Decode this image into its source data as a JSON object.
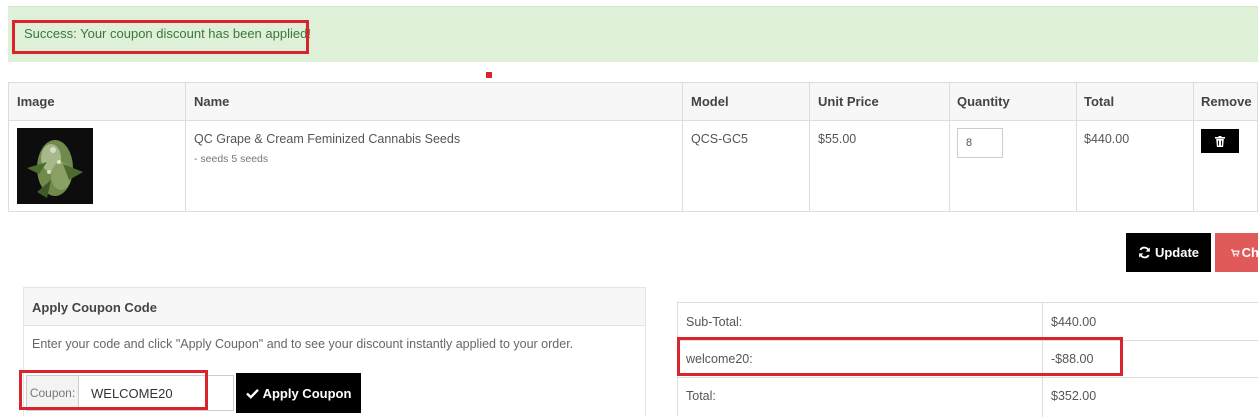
{
  "alert": {
    "message": "Success: Your coupon discount has been applied!"
  },
  "cart": {
    "headers": [
      "Image",
      "Name",
      "Model",
      "Unit Price",
      "Quantity",
      "Total",
      "Remove"
    ],
    "item": {
      "name": "QC Grape & Cream Feminized Cannabis Seeds",
      "option": "- seeds 5 seeds",
      "model": "QCS-GC5",
      "unit_price": "$55.00",
      "quantity": "8",
      "total": "$440.00"
    }
  },
  "actions": {
    "update_label": "Update",
    "checkout_label": "Ch"
  },
  "coupon": {
    "title": "Apply Coupon Code",
    "description": "Enter your code and click \"Apply Coupon\" and to see your discount instantly applied to your order.",
    "addon_label": "Coupon:",
    "code_value": "WELCOME20",
    "apply_label": "Apply Coupon"
  },
  "totals": [
    {
      "label": "Sub-Total:",
      "value": "$440.00"
    },
    {
      "label": "welcome20:",
      "value": "-$88.00"
    },
    {
      "label": "Total:",
      "value": "$352.00"
    }
  ],
  "colors": {
    "success_bg": "#dff0d8",
    "success_text": "#3c763d",
    "highlight": "#d9232d",
    "checkout": "#e05a5a"
  }
}
